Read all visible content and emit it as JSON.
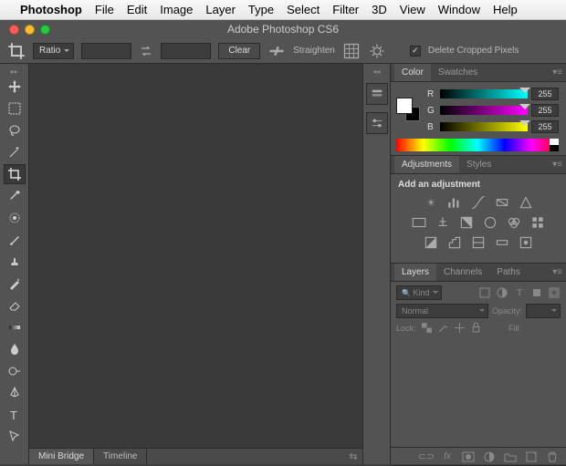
{
  "mac_menu": {
    "app": "Photoshop",
    "items": [
      "File",
      "Edit",
      "Image",
      "Layer",
      "Type",
      "Select",
      "Filter",
      "3D",
      "View",
      "Window",
      "Help"
    ]
  },
  "window_title": "Adobe Photoshop CS6",
  "options_bar": {
    "ratio_label": "Ratio",
    "clear_label": "Clear",
    "straighten_label": "Straighten",
    "delete_cropped_label": "Delete Cropped Pixels",
    "delete_cropped_checked": true
  },
  "collapsed_strip": {},
  "color_panel": {
    "tabs": [
      "Color",
      "Swatches"
    ],
    "active_tab": 0,
    "channels": [
      {
        "label": "R",
        "value": "255"
      },
      {
        "label": "G",
        "value": "255"
      },
      {
        "label": "B",
        "value": "255"
      }
    ]
  },
  "adjustments_panel": {
    "tabs": [
      "Adjustments",
      "Styles"
    ],
    "active_tab": 0,
    "hint": "Add an adjustment"
  },
  "layers_panel": {
    "tabs": [
      "Layers",
      "Channels",
      "Paths"
    ],
    "active_tab": 0,
    "kind_label": "Kind",
    "blend_mode": "Normal",
    "opacity_label": "Opacity:",
    "lock_label": "Lock:",
    "fill_label": "Fill:"
  },
  "bottom_tabs": {
    "tabs": [
      "Mini Bridge",
      "Timeline"
    ],
    "active_tab": 0
  }
}
